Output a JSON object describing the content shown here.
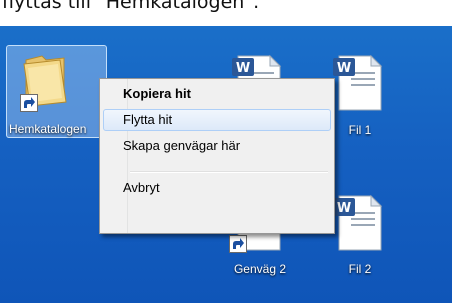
{
  "caption": {
    "text": "flyttas till \"Hemkatalogen\"."
  },
  "desktop": {
    "icons": [
      {
        "label": "Hemkatalogen"
      },
      {
        "label": ""
      },
      {
        "label": "Fil 1"
      },
      {
        "label": "Genväg 2"
      },
      {
        "label": "Fil 2"
      }
    ]
  },
  "context_menu": {
    "items": [
      {
        "label": "Kopiera hit"
      },
      {
        "label": "Flytta hit"
      },
      {
        "label": "Skapa genvägar här"
      },
      {
        "label": "Avbryt"
      }
    ]
  },
  "colors": {
    "desktop_blue": "#1560c1",
    "menu_background": "#f0f0f0",
    "hover_border": "#aecff7",
    "word_blue": "#2b5797"
  },
  "icons": [
    "folder-icon",
    "shortcut-arrow-icon",
    "word-document-icon"
  ]
}
